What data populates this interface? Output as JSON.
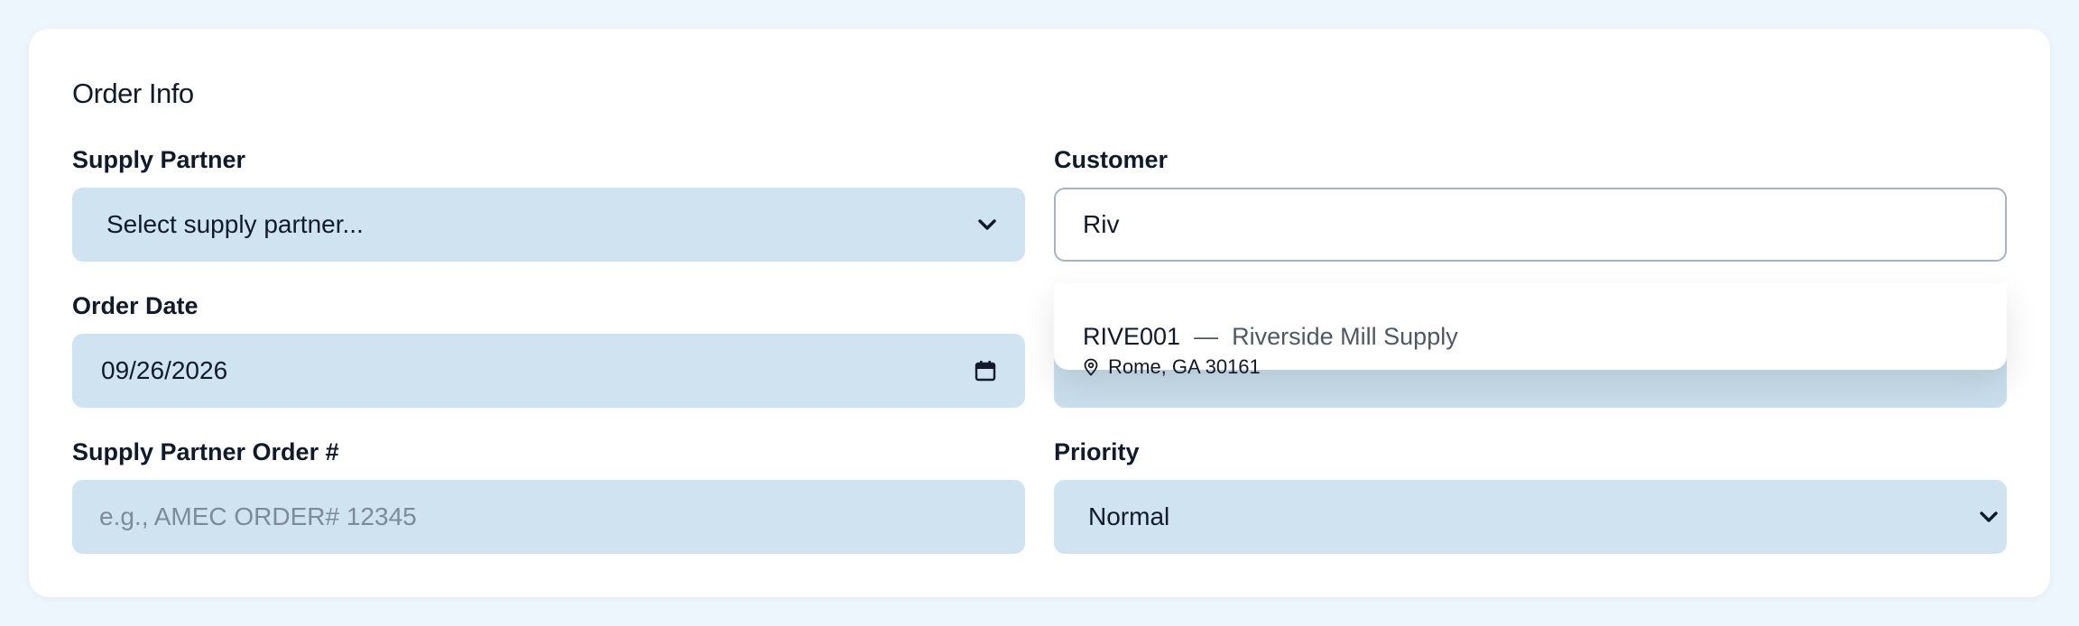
{
  "order_info": {
    "title": "Order Info",
    "supply_partner": {
      "label": "Supply Partner",
      "selected": "Select supply partner..."
    },
    "customer": {
      "label": "Customer",
      "value": "Riv",
      "suggestions": [
        {
          "code": "RIVE001",
          "separator": "—",
          "name": "Riverside Mill Supply",
          "location": "Rome, GA 30161"
        }
      ]
    },
    "order_date": {
      "label": "Order Date",
      "value": "09/26/2026"
    },
    "supply_partner_order": {
      "label": "Supply Partner Order #",
      "placeholder": "e.g., AMEC ORDER# 12345"
    },
    "priority": {
      "label": "Priority",
      "selected": "Normal"
    }
  },
  "colors": {
    "page_bg": "#eef6fd",
    "card_bg": "#ffffff",
    "field_bg": "#cfe3f0",
    "text": "#111a2a",
    "muted": "#7d8b98"
  },
  "icons": {
    "select_arrow": "chevron-down-icon",
    "date_picker": "calendar-icon",
    "location": "map-pin-icon"
  }
}
